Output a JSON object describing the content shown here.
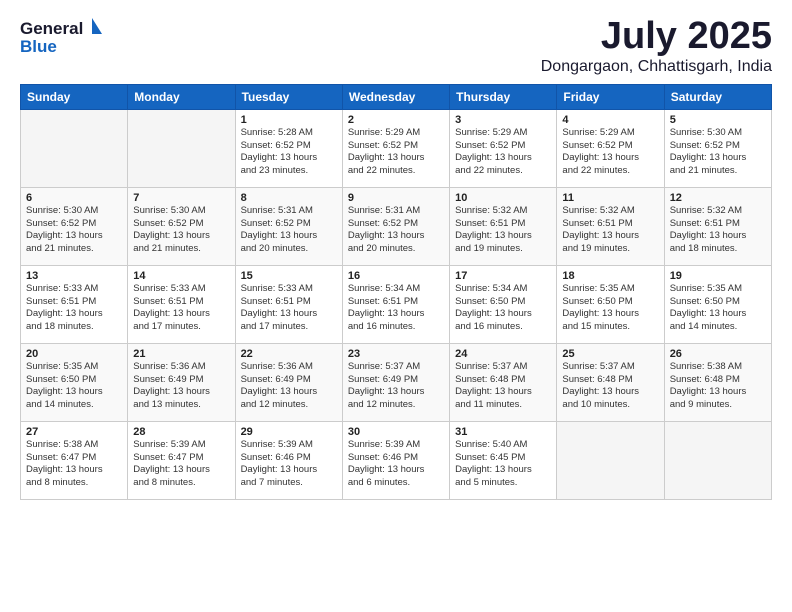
{
  "logo": {
    "general": "General",
    "blue": "Blue"
  },
  "title": "July 2025",
  "subtitle": "Dongargaon, Chhattisgarh, India",
  "weekdays": [
    "Sunday",
    "Monday",
    "Tuesday",
    "Wednesday",
    "Thursday",
    "Friday",
    "Saturday"
  ],
  "weeks": [
    [
      {
        "day": "",
        "info": ""
      },
      {
        "day": "",
        "info": ""
      },
      {
        "day": "1",
        "info": "Sunrise: 5:28 AM\nSunset: 6:52 PM\nDaylight: 13 hours\nand 23 minutes."
      },
      {
        "day": "2",
        "info": "Sunrise: 5:29 AM\nSunset: 6:52 PM\nDaylight: 13 hours\nand 22 minutes."
      },
      {
        "day": "3",
        "info": "Sunrise: 5:29 AM\nSunset: 6:52 PM\nDaylight: 13 hours\nand 22 minutes."
      },
      {
        "day": "4",
        "info": "Sunrise: 5:29 AM\nSunset: 6:52 PM\nDaylight: 13 hours\nand 22 minutes."
      },
      {
        "day": "5",
        "info": "Sunrise: 5:30 AM\nSunset: 6:52 PM\nDaylight: 13 hours\nand 21 minutes."
      }
    ],
    [
      {
        "day": "6",
        "info": "Sunrise: 5:30 AM\nSunset: 6:52 PM\nDaylight: 13 hours\nand 21 minutes."
      },
      {
        "day": "7",
        "info": "Sunrise: 5:30 AM\nSunset: 6:52 PM\nDaylight: 13 hours\nand 21 minutes."
      },
      {
        "day": "8",
        "info": "Sunrise: 5:31 AM\nSunset: 6:52 PM\nDaylight: 13 hours\nand 20 minutes."
      },
      {
        "day": "9",
        "info": "Sunrise: 5:31 AM\nSunset: 6:52 PM\nDaylight: 13 hours\nand 20 minutes."
      },
      {
        "day": "10",
        "info": "Sunrise: 5:32 AM\nSunset: 6:51 PM\nDaylight: 13 hours\nand 19 minutes."
      },
      {
        "day": "11",
        "info": "Sunrise: 5:32 AM\nSunset: 6:51 PM\nDaylight: 13 hours\nand 19 minutes."
      },
      {
        "day": "12",
        "info": "Sunrise: 5:32 AM\nSunset: 6:51 PM\nDaylight: 13 hours\nand 18 minutes."
      }
    ],
    [
      {
        "day": "13",
        "info": "Sunrise: 5:33 AM\nSunset: 6:51 PM\nDaylight: 13 hours\nand 18 minutes."
      },
      {
        "day": "14",
        "info": "Sunrise: 5:33 AM\nSunset: 6:51 PM\nDaylight: 13 hours\nand 17 minutes."
      },
      {
        "day": "15",
        "info": "Sunrise: 5:33 AM\nSunset: 6:51 PM\nDaylight: 13 hours\nand 17 minutes."
      },
      {
        "day": "16",
        "info": "Sunrise: 5:34 AM\nSunset: 6:51 PM\nDaylight: 13 hours\nand 16 minutes."
      },
      {
        "day": "17",
        "info": "Sunrise: 5:34 AM\nSunset: 6:50 PM\nDaylight: 13 hours\nand 16 minutes."
      },
      {
        "day": "18",
        "info": "Sunrise: 5:35 AM\nSunset: 6:50 PM\nDaylight: 13 hours\nand 15 minutes."
      },
      {
        "day": "19",
        "info": "Sunrise: 5:35 AM\nSunset: 6:50 PM\nDaylight: 13 hours\nand 14 minutes."
      }
    ],
    [
      {
        "day": "20",
        "info": "Sunrise: 5:35 AM\nSunset: 6:50 PM\nDaylight: 13 hours\nand 14 minutes."
      },
      {
        "day": "21",
        "info": "Sunrise: 5:36 AM\nSunset: 6:49 PM\nDaylight: 13 hours\nand 13 minutes."
      },
      {
        "day": "22",
        "info": "Sunrise: 5:36 AM\nSunset: 6:49 PM\nDaylight: 13 hours\nand 12 minutes."
      },
      {
        "day": "23",
        "info": "Sunrise: 5:37 AM\nSunset: 6:49 PM\nDaylight: 13 hours\nand 12 minutes."
      },
      {
        "day": "24",
        "info": "Sunrise: 5:37 AM\nSunset: 6:48 PM\nDaylight: 13 hours\nand 11 minutes."
      },
      {
        "day": "25",
        "info": "Sunrise: 5:37 AM\nSunset: 6:48 PM\nDaylight: 13 hours\nand 10 minutes."
      },
      {
        "day": "26",
        "info": "Sunrise: 5:38 AM\nSunset: 6:48 PM\nDaylight: 13 hours\nand 9 minutes."
      }
    ],
    [
      {
        "day": "27",
        "info": "Sunrise: 5:38 AM\nSunset: 6:47 PM\nDaylight: 13 hours\nand 8 minutes."
      },
      {
        "day": "28",
        "info": "Sunrise: 5:39 AM\nSunset: 6:47 PM\nDaylight: 13 hours\nand 8 minutes."
      },
      {
        "day": "29",
        "info": "Sunrise: 5:39 AM\nSunset: 6:46 PM\nDaylight: 13 hours\nand 7 minutes."
      },
      {
        "day": "30",
        "info": "Sunrise: 5:39 AM\nSunset: 6:46 PM\nDaylight: 13 hours\nand 6 minutes."
      },
      {
        "day": "31",
        "info": "Sunrise: 5:40 AM\nSunset: 6:45 PM\nDaylight: 13 hours\nand 5 minutes."
      },
      {
        "day": "",
        "info": ""
      },
      {
        "day": "",
        "info": ""
      }
    ]
  ]
}
